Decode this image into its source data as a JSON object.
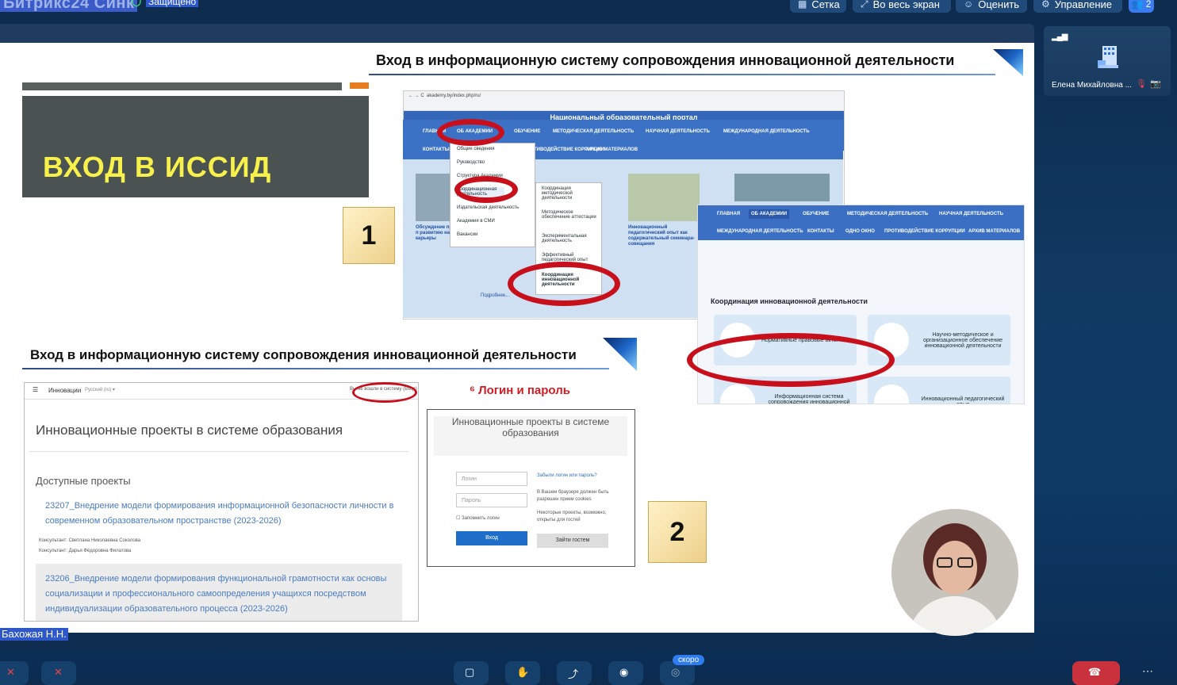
{
  "app": {
    "title": "Битрикс24 Синк",
    "secure_label": "Защищено"
  },
  "top_buttons": [
    {
      "label": "Сетка",
      "icon": "grid-icon"
    },
    {
      "label": "Во весь экран",
      "icon": "fullscreen-icon"
    },
    {
      "label": "Оценить",
      "icon": "rate-icon"
    },
    {
      "label": "Управление",
      "icon": "gear-icon"
    }
  ],
  "participants_count": "2",
  "participant": {
    "name": "Елена Михайловна ..."
  },
  "speaker_name": "Бахожая Н.Н.",
  "soon_badge": "скоро",
  "slide": {
    "title": "ВХОД В ИССИД",
    "header1": "Вход  в информационную систему сопровождения инновационной деятельности",
    "header2": "Вход  в информационную систему сопровождения инновационной деятельности",
    "step1": "1",
    "step2": "2",
    "login_title": "⁶ Логин и пароль",
    "portal": {
      "url": "akademy.by/index.php/ru/",
      "site_title": "Национальный образовательный портал",
      "nav": [
        "ГЛАВНАЯ",
        "ОБ АКАДЕМИИ",
        "ОБУЧЕНИЕ",
        "МЕТОДИЧЕСКАЯ ДЕЯТЕЛЬНОСТЬ",
        "НАУЧНАЯ ДЕЯТЕЛЬНОСТЬ",
        "МЕЖДУНАРОДНАЯ ДЕЯТЕЛЬНОСТЬ"
      ],
      "nav2": [
        "КОНТАКТЫ",
        "ТИВОДЕЙСТВИЕ КОРРУПЦИИ",
        "АРХИВ МАТЕРИАЛОВ"
      ],
      "menu": [
        "Общие сведения",
        "Руководство",
        "Структура Академии",
        "Координационная деятельность",
        "Издательская деятельность",
        "Академия в СМИ",
        "Вакансии"
      ],
      "submenu": [
        "Координация методической деятельности",
        "Методическое обеспечение аттестации",
        "Экспериментальная деятельность",
        "Эффективный педагогический опыт",
        "Координация инновационной деятельности"
      ],
      "news1": "Обсуждение программы ф занятий по п развитию навыков выстраивания карьеры",
      "news2": "Инновационный педагогический опыт как содержательный семинара-совещания",
      "more": "Подробнее..."
    },
    "coord": {
      "nav": [
        "ГЛАВНАЯ",
        "ОБ АКАДЕМИИ",
        "ОБУЧЕНИЕ",
        "МЕТОДИЧЕСКАЯ ДЕЯТЕЛЬНОСТЬ",
        "НАУЧНАЯ ДЕЯТЕЛЬНОСТЬ"
      ],
      "nav2": [
        "МЕЖДУНАРОДНАЯ ДЕЯТЕЛЬНОСТЬ",
        "КОНТАКТЫ",
        "ОДНО ОКНО",
        "ПРОТИВОДЕЙСТВИЕ КОРРУПЦИИ",
        "АРХИВ МАТЕРИАЛОВ"
      ],
      "heading": "Координация инновационной деятельности",
      "cards": [
        "Нормативные правовые акты",
        "Научно-методическое и организационное обеспечение инновационной деятельности",
        "Информационная система сопровождения инновационной деятельности",
        "Инновационный педагогический опыт"
      ]
    },
    "projects": {
      "topbar": "Инновации",
      "lang": "Русский (ru) ▾",
      "login_link": "Вы не вошли в систему (Вход)",
      "title": "Инновационные проекты в системе образования",
      "subtitle": "Доступные проекты",
      "p1": "23207_Внедрение модели формирования информационной безопасности личности в современном образовательном пространстве (2023-2026)",
      "p1_c1": "Консультант: Светлана Николаевна Соколова",
      "p1_c2": "Консультант: Дарья Фёдоровна Филатова",
      "p2": "23206_Внедрение модели формирования функциональной грамотности как основы социализации и профессионального самоопределения учащихся посредством индивидуализации образовательного процесса (2023-2026)"
    },
    "login": {
      "title": "Инновационные проекты в системе образования",
      "login_ph": "Логин",
      "pass_ph": "Пароль",
      "remember": "Запомнить логин",
      "enter": "Вход",
      "forgot": "Забыли логин или пароль?",
      "cookies": "В Вашем браузере должен быть разрешен прием cookies",
      "guests": "Некоторые проекты, возможно, открыты для гостей",
      "guest_btn": "Зайти гостем"
    }
  }
}
